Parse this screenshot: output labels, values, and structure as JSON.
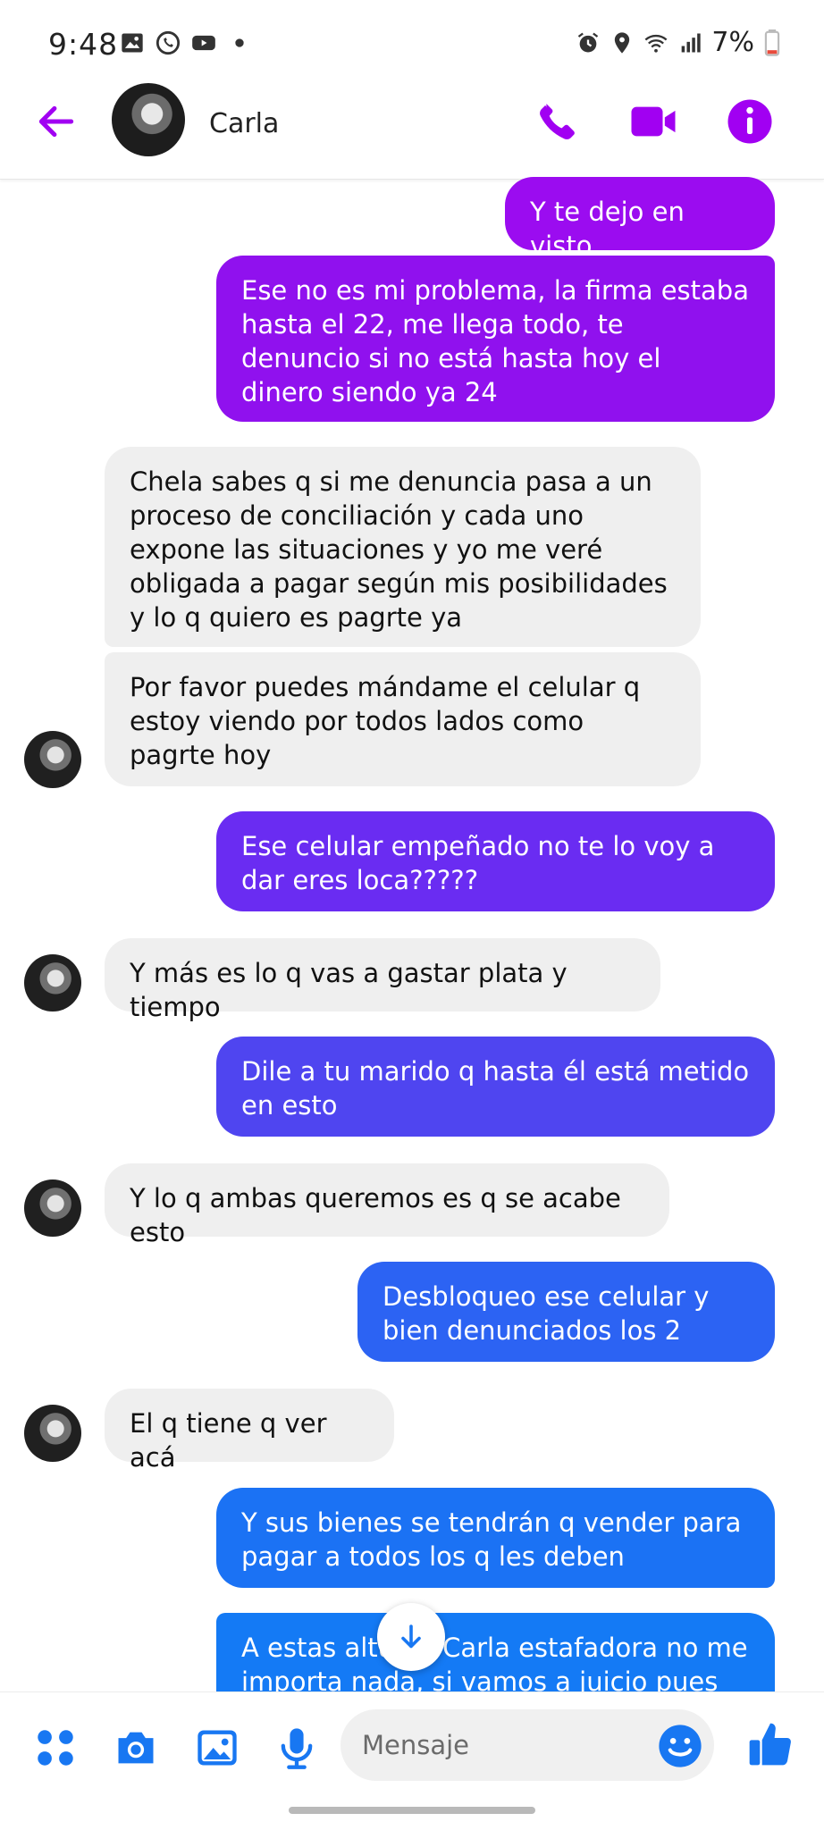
{
  "status_bar": {
    "time": "9:48",
    "battery": "7%",
    "left_icons": [
      "gallery-icon",
      "whatsapp-icon",
      "youtube-icon",
      "dot-icon"
    ],
    "right_icons": [
      "alarm-icon",
      "location-icon",
      "wifi-icon",
      "signal-icon",
      "battery-icon"
    ]
  },
  "header": {
    "contact_name": "Carla",
    "accent_color": "#a100f2",
    "actions": [
      "phone-icon",
      "video-icon",
      "info-icon"
    ]
  },
  "messages": [
    {
      "direction": "out",
      "text": "Y te dejo en visto",
      "color": "#9b0cf0"
    },
    {
      "direction": "out",
      "text": "Ese no es mi problema, la firma estaba hasta el 22, me llega todo, te denuncio si no está hasta hoy el dinero siendo ya 24",
      "color": "#9011ee"
    },
    {
      "direction": "in",
      "text": "Chela sabes q si me denuncia pasa a un proceso de conciliación y cada uno expone las situaciones y yo me veré obligada a pagar según mis posibilidades y lo q quiero es pagrte ya"
    },
    {
      "direction": "in",
      "text": "Por favor puedes mándame el celular q estoy viendo por todos lados como pagrte hoy"
    },
    {
      "direction": "out",
      "text": "Ese celular empeñado no te lo voy a dar eres loca?????",
      "color": "#6a2cf2"
    },
    {
      "direction": "in",
      "text": "Y más es lo q vas a gastar plata y tiempo"
    },
    {
      "direction": "out",
      "text": "Dile a tu marido q hasta él está metido en esto",
      "color": "#4f45f0"
    },
    {
      "direction": "in",
      "text": "Y lo q ambas queremos es q se acabe esto"
    },
    {
      "direction": "out",
      "text": "Desbloqueo ese celular y bien denunciados los 2",
      "color": "#2c63f3"
    },
    {
      "direction": "in",
      "text": "El q tiene q ver acá"
    },
    {
      "direction": "out",
      "text": "Y sus bienes se tendrán q vender para pagar a todos los q les deben",
      "color": "#1b72f4"
    },
    {
      "direction": "out",
      "text": "A estas alturas Carla estafadora no me importa nada, si vamos a juicio pues",
      "color": "#147af5"
    }
  ],
  "composer": {
    "placeholder": "Mensaje",
    "accent_color": "#1877f2",
    "icons": [
      "apps-icon",
      "camera-icon",
      "gallery-icon",
      "mic-icon",
      "emoji-icon",
      "like-icon"
    ]
  }
}
